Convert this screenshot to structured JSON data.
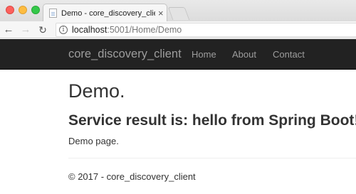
{
  "browser": {
    "tab_title": "Demo - core_discovery_client",
    "tab_close": "×",
    "url_host": "localhost",
    "url_rest": ":5001/Home/Demo",
    "back_glyph": "←",
    "forward_glyph": "→",
    "reload_glyph": "↻",
    "info_glyph": "i",
    "traffic_light_colors": {
      "close": "#fc605c",
      "minimize": "#fdbc40",
      "maximize": "#34c84a"
    }
  },
  "navbar": {
    "brand": "core_discovery_client",
    "links": [
      {
        "label": "Home"
      },
      {
        "label": "About"
      },
      {
        "label": "Contact"
      }
    ],
    "background": "#222222",
    "text_color": "#9d9d9d"
  },
  "main": {
    "title": "Demo.",
    "service_result": "Service result is: hello from Spring Boot!",
    "description": "Demo page."
  },
  "footer": {
    "text": "© 2017 - core_discovery_client"
  }
}
